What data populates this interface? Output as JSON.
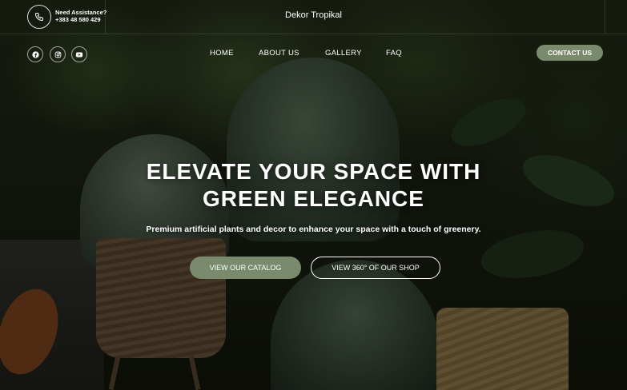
{
  "header": {
    "assistance_label": "Need Assistance?",
    "phone": "+383 48 580 429",
    "brand": "Dekor Tropikal",
    "contact_button": "CONTACT US"
  },
  "social": [
    {
      "icon": "facebook-icon"
    },
    {
      "icon": "instagram-icon"
    },
    {
      "icon": "youtube-icon"
    }
  ],
  "nav": {
    "items": [
      {
        "label": "HOME"
      },
      {
        "label": "ABOUT US"
      },
      {
        "label": "GALLERY"
      },
      {
        "label": "FAQ"
      }
    ]
  },
  "hero": {
    "headline_line1": "ELEVATE YOUR SPACE WITH",
    "headline_line2": "GREEN ELEGANCE",
    "subtitle": "Premium artificial plants and decor to enhance your space with a touch of greenery.",
    "catalog_button": "VIEW OUR CATALOG",
    "tour_button": "VIEW 360° OF OUR SHOP"
  },
  "colors": {
    "accent": "#7a8a6c",
    "text": "#ffffff"
  }
}
